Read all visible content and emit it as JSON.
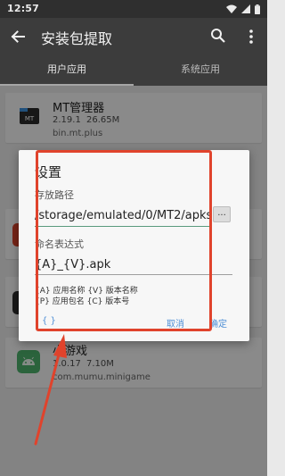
{
  "status_bar": {
    "time": "12:57",
    "icons": [
      "wifi-icon",
      "signal-icon",
      "battery-icon"
    ]
  },
  "toolbar": {
    "title": "安装包提取",
    "icons": [
      "arrow-back-icon",
      "search-icon",
      "more-vert-icon"
    ]
  },
  "tabs": [
    {
      "label": "用户应用",
      "active": true
    },
    {
      "label": "系统应用",
      "active": false
    }
  ],
  "apps": [
    {
      "name": "MT管理器",
      "version": "2.19.1",
      "size": "26.65M",
      "package": "bin.mt.plus",
      "icon": "mt-manager-icon"
    },
    {
      "name": "小游戏",
      "version": "1.0.17",
      "size": "7.10M",
      "package": "com.mumu.minigame",
      "icon": "android-robot-icon"
    }
  ],
  "dialog": {
    "title": "设置",
    "path_label": "存放路径",
    "path_value": "/storage/emulated/0/MT2/apks",
    "browse_label": "...",
    "name_label": "命名表达式",
    "name_value": "{A}_{V}.apk",
    "hint_line1": "{A} 应用名称 {V} 版本名称",
    "hint_line2": "{P} 应用包名 {C} 版本号",
    "default_button": "{ }",
    "cancel_button": "取消",
    "confirm_button": "确定"
  },
  "colors": {
    "toolbar": "#3c3c3c",
    "accent_text": "#4f8fd6",
    "annotation": "#e0432c",
    "input_underline": "#5a9a7d"
  }
}
